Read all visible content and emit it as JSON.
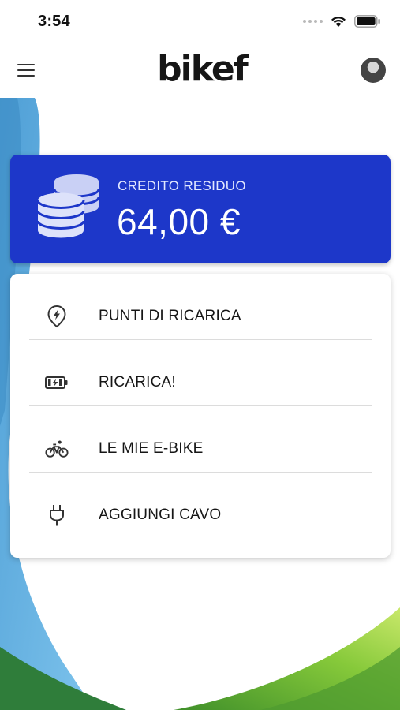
{
  "status_bar": {
    "time": "3:54",
    "icons": [
      "signal-dots-icon",
      "wifi-icon",
      "battery-icon"
    ]
  },
  "header": {
    "logo_text": "bikef",
    "menu_icon": "hamburger-menu-icon",
    "avatar_icon": "user-avatar"
  },
  "credit": {
    "label": "CREDITO RESIDUO",
    "amount": "64,00 €",
    "icon": "coins-icon",
    "color": "#1D37C9"
  },
  "menu": {
    "items": [
      {
        "label": "PUNTI DI RICARICA",
        "icon": "charging-location-pin-icon"
      },
      {
        "label": "RICARICA!",
        "icon": "battery-charging-icon"
      },
      {
        "label": "LE MIE E-BIKE",
        "icon": "bicycle-icon"
      },
      {
        "label": "AGGIUNGI CAVO",
        "icon": "plug-icon"
      }
    ]
  },
  "colors": {
    "accent_blue": "#1D37C9",
    "decor_light_blue": "#5FB4E4",
    "decor_green": "#7CC63A"
  }
}
